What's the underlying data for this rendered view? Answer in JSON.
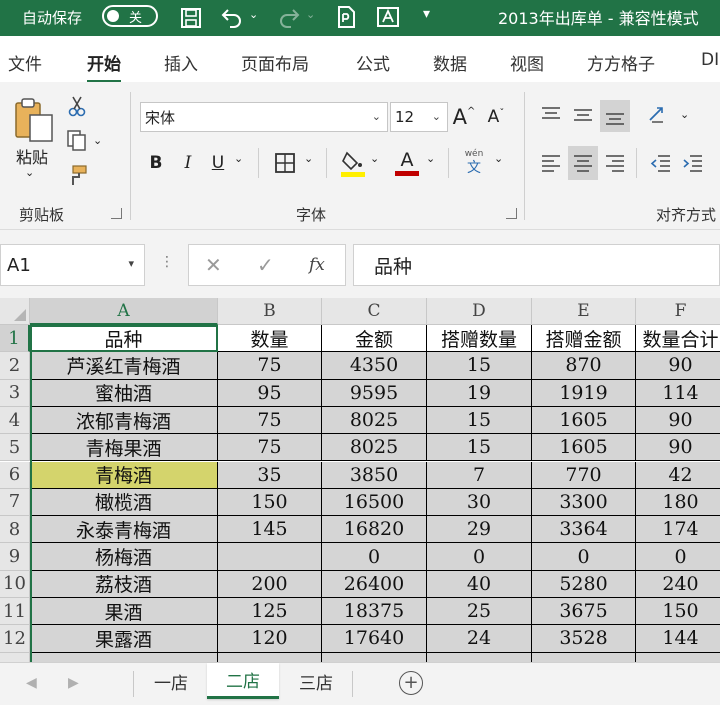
{
  "titlebar": {
    "autosave_label": "自动保存",
    "autosave_state": "关",
    "doc_title": "2013年出库单 - 兼容性模式",
    "bg_color": "#217346"
  },
  "menu": {
    "tabs": [
      "文件",
      "开始",
      "插入",
      "页面布局",
      "公式",
      "数据",
      "视图",
      "方方格子",
      "DI"
    ],
    "active": "开始"
  },
  "ribbon": {
    "clipboard": {
      "paste": "粘贴",
      "group": "剪贴板"
    },
    "font": {
      "name": "宋体",
      "size": "12",
      "grow": "A",
      "shrink": "A",
      "bold": "B",
      "italic": "I",
      "underline": "U",
      "font_color_letter": "A",
      "phonetic_top": "wén",
      "phonetic_bottom": "文",
      "group": "字体",
      "fill_color": "#ffef00",
      "text_color": "#c00000"
    },
    "align": {
      "group": "对齐方式"
    }
  },
  "formula": {
    "cell_ref": "A1",
    "dots": "⋮",
    "cancel": "✕",
    "enter": "✓",
    "fx": "fx",
    "content": "品种"
  },
  "sheet": {
    "columns": [
      "A",
      "B",
      "C",
      "D",
      "E",
      "F"
    ],
    "row_numbers": [
      "1",
      "2",
      "3",
      "4",
      "5",
      "6",
      "7",
      "8",
      "9",
      "10",
      "11",
      "12"
    ],
    "headers": [
      "品种",
      "数量",
      "金额",
      "搭赠数量",
      "搭赠金额",
      "数量合计"
    ],
    "rows": [
      [
        "芦溪红青梅酒",
        "75",
        "4350",
        "15",
        "870",
        "90"
      ],
      [
        "蜜柚酒",
        "95",
        "9595",
        "19",
        "1919",
        "114"
      ],
      [
        "浓郁青梅酒",
        "75",
        "8025",
        "15",
        "1605",
        "90"
      ],
      [
        "青梅果酒",
        "75",
        "8025",
        "15",
        "1605",
        "90"
      ],
      [
        "青梅酒",
        "35",
        "3850",
        "7",
        "770",
        "42"
      ],
      [
        "橄榄酒",
        "150",
        "16500",
        "30",
        "3300",
        "180"
      ],
      [
        "永泰青梅酒",
        "145",
        "16820",
        "29",
        "3364",
        "174"
      ],
      [
        "杨梅酒",
        "",
        "0",
        "0",
        "0",
        "0"
      ],
      [
        "荔枝酒",
        "200",
        "26400",
        "40",
        "5280",
        "240"
      ],
      [
        "果酒",
        "125",
        "18375",
        "25",
        "3675",
        "150"
      ],
      [
        "果露酒",
        "120",
        "17640",
        "24",
        "3528",
        "144"
      ]
    ],
    "highlight_cell": "A6",
    "highlight_color": "#d4d46c"
  },
  "sheet_tabs": {
    "tabs": [
      "一店",
      "二店",
      "三店"
    ],
    "active": "二店",
    "add": "+"
  }
}
